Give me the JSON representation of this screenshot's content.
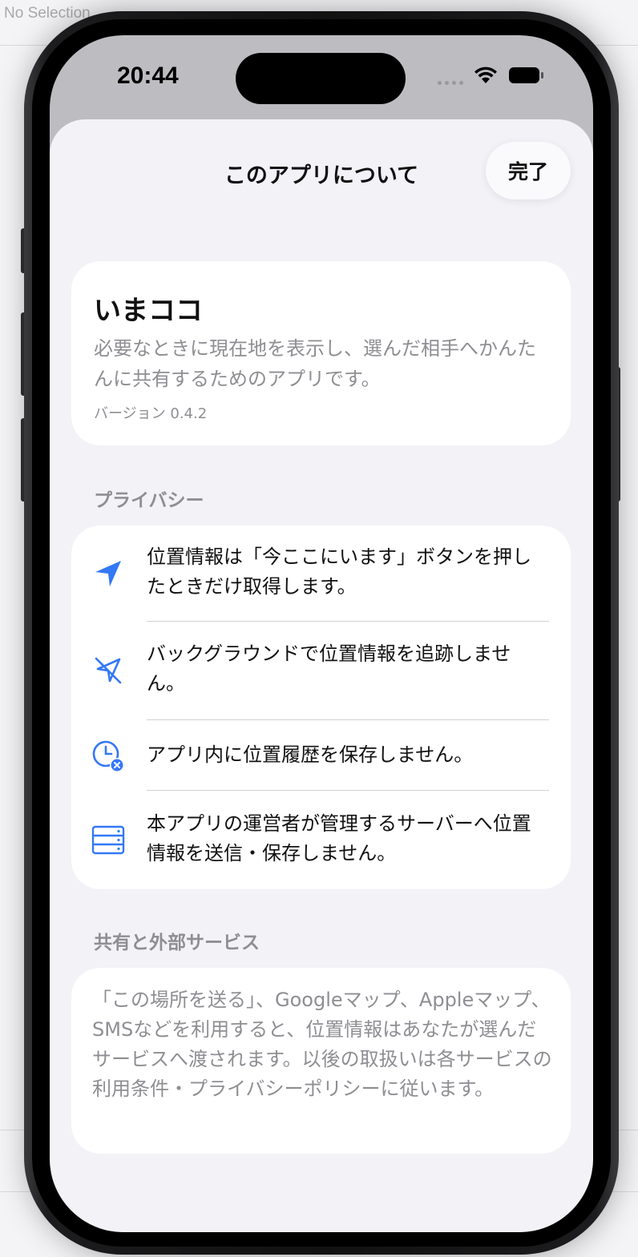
{
  "xcode": {
    "no_selection": "No Selection"
  },
  "status_bar": {
    "time": "20:44"
  },
  "sheet": {
    "title": "このアプリについて",
    "done_label": "完了"
  },
  "app_info": {
    "name": "いまココ",
    "description": "必要なときに現在地を表示し、選んだ相手へかんたんに共有するためのアプリです。",
    "version": "バージョン 0.4.2"
  },
  "privacy": {
    "header": "プライバシー",
    "items": [
      {
        "icon": "location-arrow-icon",
        "text": "位置情報は「今ここにいます」ボタンを押したときだけ取得します。"
      },
      {
        "icon": "location-slash-icon",
        "text": "バックグラウンドで位置情報を追跡しません。"
      },
      {
        "icon": "clock-x-icon",
        "text": "アプリ内に位置履歴を保存しません。"
      },
      {
        "icon": "server-icon",
        "text": "本アプリの運営者が管理するサーバーへ位置情報を送信・保存しません。"
      }
    ]
  },
  "sharing": {
    "header": "共有と外部サービス",
    "text": "「この場所を送る」、Googleマップ、Appleマップ、SMSなどを利用すると、位置情報はあなたが選んだサービスへ渡されます。以後の取扱いは各サービスの利用条件・プライバシーポリシーに従います。"
  },
  "colors": {
    "accent": "#3478f6",
    "secondary_text": "#8e8e93",
    "background": "#f2f2f7"
  }
}
